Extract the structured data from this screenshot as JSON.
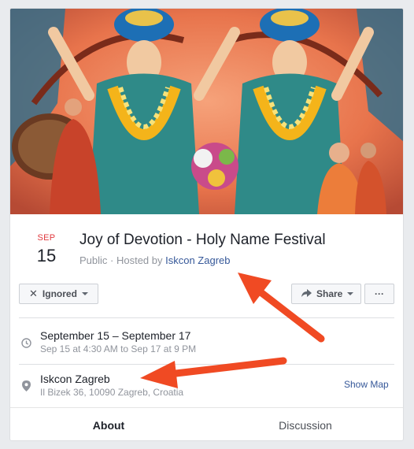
{
  "event": {
    "month": "SEP",
    "day": "15",
    "title": "Joy of Devotion - Holy Name Festival",
    "privacy_text": "Public · Hosted by ",
    "host": "Iskcon Zagreb"
  },
  "actions": {
    "ignored_label": "Ignored",
    "share_label": "Share",
    "more_label": "···"
  },
  "details": {
    "date_range": "September 15 – September 17",
    "time_range": "Sep 15 at 4:30 AM to Sep 17 at 9 PM",
    "place_name": "Iskcon Zagreb",
    "address": "Il Bizek 36, 10090 Zagreb, Croatia",
    "show_map": "Show Map"
  },
  "tabs": {
    "about": "About",
    "discussion": "Discussion"
  },
  "colors": {
    "accent": "#4267b2",
    "month": "#e0393e",
    "link": "#365899",
    "annotation_arrow": "#f04a23"
  },
  "icons": {
    "ignored": "close-icon",
    "share": "share-arrow-icon",
    "time": "clock-icon",
    "place": "map-pin-icon"
  }
}
